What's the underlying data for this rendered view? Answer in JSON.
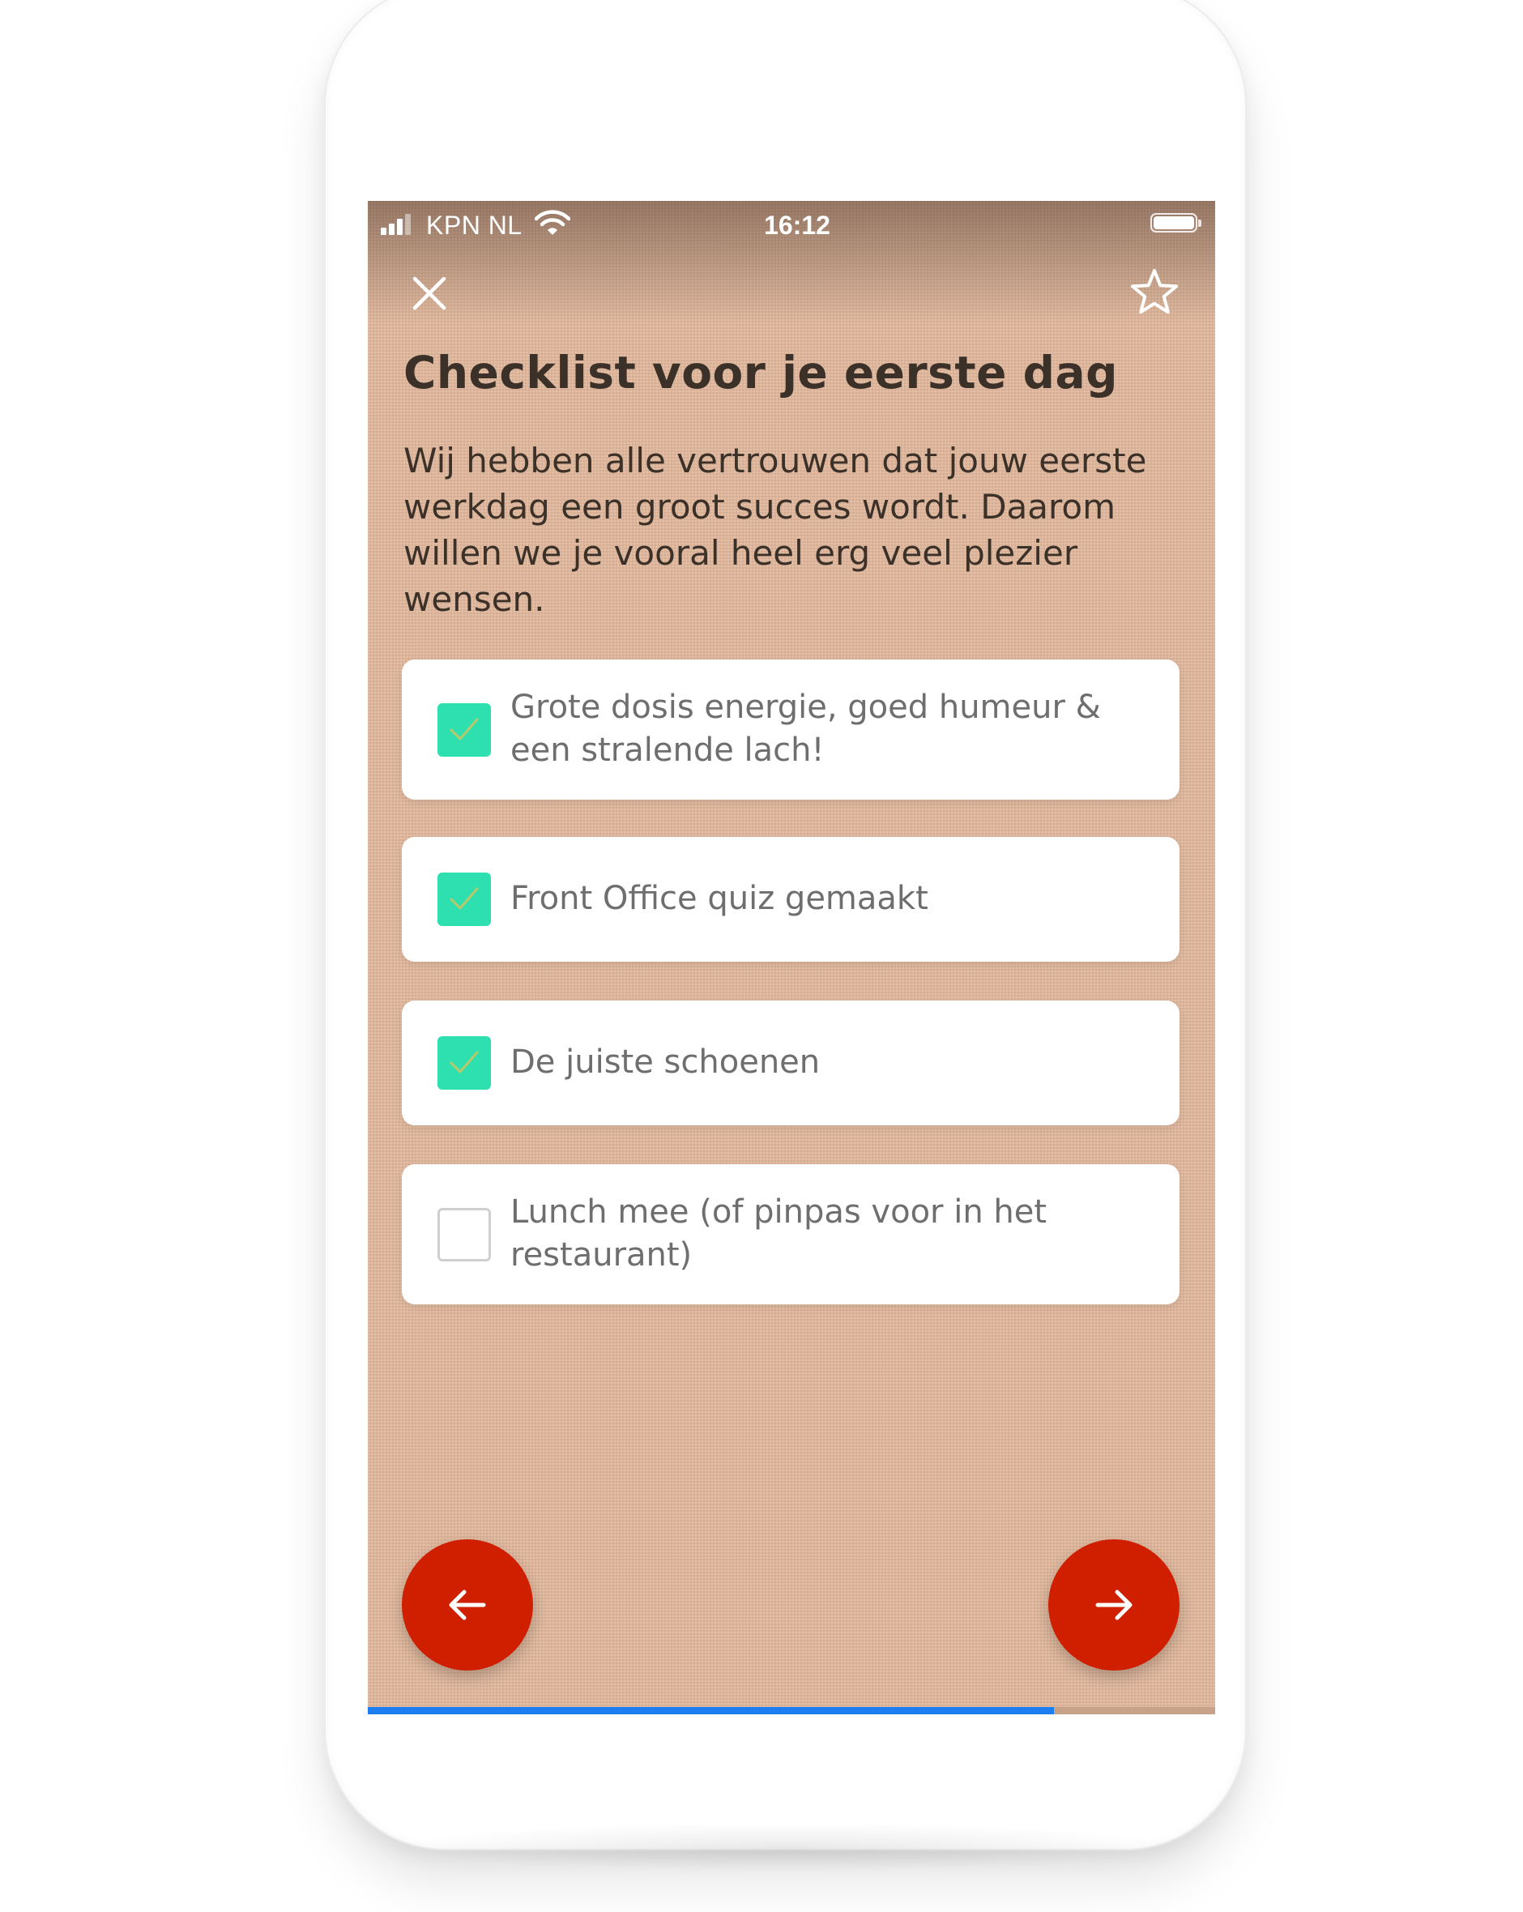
{
  "status_bar": {
    "carrier": "KPN NL",
    "time": "16:12",
    "signal_icon": "signal-bars-icon",
    "wifi_icon": "wifi-icon",
    "battery_icon": "battery-icon"
  },
  "toolbar": {
    "close_icon": "close-icon",
    "favorite_icon": "star-outline-icon"
  },
  "page": {
    "title": "Checklist voor je eerste dag",
    "intro": "Wij hebben alle vertrouwen dat jouw eerste werkdag een groot succes wordt. Daarom willen we je vooral heel erg veel plezier wensen."
  },
  "checklist": [
    {
      "label": "Grote dosis energie, goed humeur & een stralende lach!",
      "checked": true
    },
    {
      "label": "Front Office quiz gemaakt",
      "checked": true
    },
    {
      "label": "De juiste schoenen",
      "checked": true
    },
    {
      "label": "Lunch mee (of pinpas voor in het restaurant)",
      "checked": false
    }
  ],
  "navigation": {
    "back_icon": "arrow-left-icon",
    "next_icon": "arrow-right-icon"
  },
  "progress": {
    "fraction": 0.81
  },
  "colors": {
    "background": "#e2b89c",
    "text": "#3b3129",
    "check_accent": "#2ee0b0",
    "fab": "#cf1f00",
    "progress": "#1d7ef2"
  }
}
